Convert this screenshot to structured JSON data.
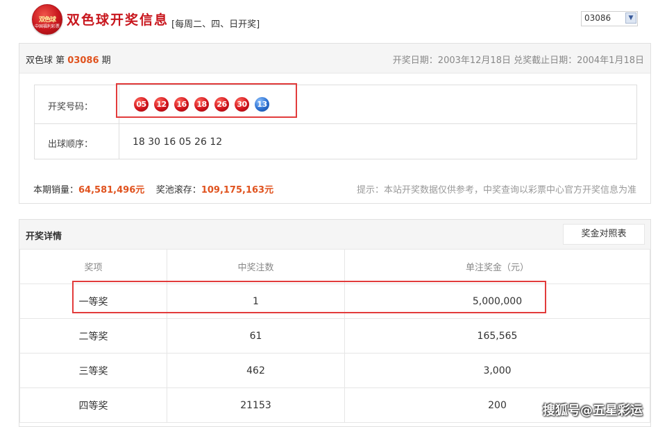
{
  "header": {
    "logo_text": "双色球",
    "logo_sub": "中国福利彩票",
    "title": "双色球开奖信息",
    "schedule": "[每周二、四、日开奖]",
    "period_select_value": "03086"
  },
  "draw": {
    "issue_prefix": "双色球 第",
    "issue_number": "03086",
    "issue_suffix": "期",
    "dates": "开奖日期：2003年12月18日 兑奖截止日期：2004年1月18日",
    "winning_label": "开奖号码：",
    "red_balls": [
      "05",
      "12",
      "16",
      "18",
      "26",
      "30"
    ],
    "blue_ball": "13",
    "order_label": "出球顺序：",
    "order": "18 30 16 05 26 12",
    "sales_label": "本期销量：",
    "sales_value": "64,581,496元",
    "pool_label": "奖池滚存：",
    "pool_value": "109,175,163元",
    "tip": "提示：本站开奖数据仅供参考，中奖查询以彩票中心官方开奖信息为准"
  },
  "details": {
    "title": "开奖详情",
    "prize_table_button": "奖金对照表",
    "headers": [
      "奖项",
      "中奖注数",
      "单注奖金（元）"
    ],
    "rows": [
      [
        "一等奖",
        "1",
        "5,000,000"
      ],
      [
        "二等奖",
        "61",
        "165,565"
      ],
      [
        "三等奖",
        "462",
        "3,000"
      ],
      [
        "四等奖",
        "21153",
        "200"
      ]
    ]
  },
  "watermark": "搜狐号@五星彩运",
  "colors": {
    "brand_red": "#c8161d",
    "accent_orange": "#e0531f",
    "highlight_red": "#e23b3b",
    "blue_ball": "#2a6fd0"
  }
}
